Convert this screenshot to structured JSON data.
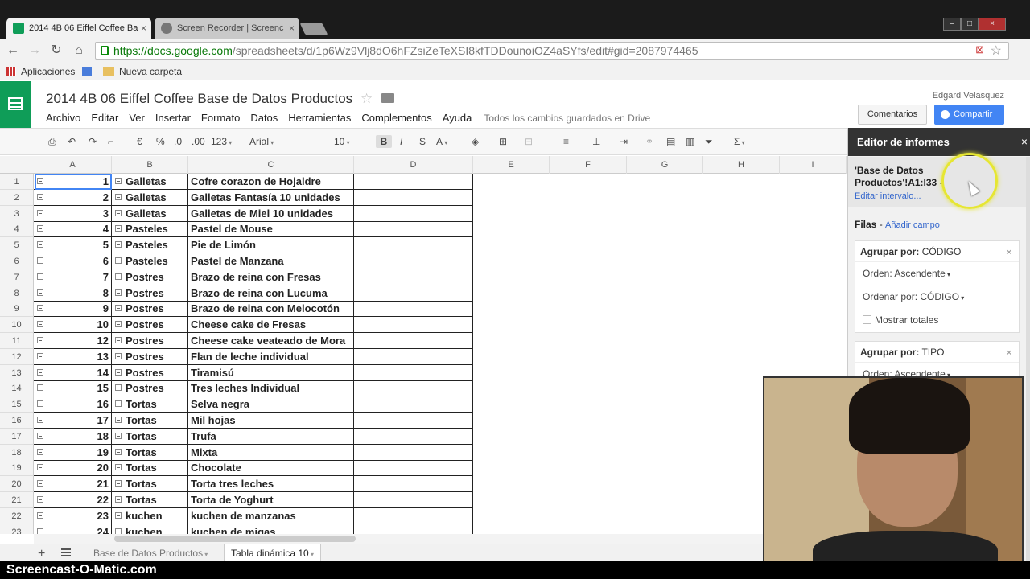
{
  "browser": {
    "tabs": [
      {
        "label": "2014 4B 06 Eiffel Coffee Ba",
        "close": "×",
        "active": true
      },
      {
        "label": "Screen Recorder | Screenc",
        "close": "×",
        "active": false
      }
    ],
    "url_host": "https://docs.google.com",
    "url_path": "/spreadsheets/d/1p6Wz9Vlj8dO6hFZsiZeTeXSI8kfTDDounoiOZ4aSYfs/edit#gid=2087974465",
    "bookmarks": [
      "Aplicaciones",
      "Nueva carpeta"
    ]
  },
  "doc": {
    "title": "2014 4B 06 Eiffel Coffee Base de Datos Productos",
    "menu": [
      "Archivo",
      "Editar",
      "Ver",
      "Insertar",
      "Formato",
      "Datos",
      "Herramientas",
      "Complementos",
      "Ayuda"
    ],
    "saved_status": "Todos los cambios guardados en Drive",
    "user": "Edgard Velasquez",
    "comments_label": "Comentarios",
    "share_label": "Compartir"
  },
  "toolbar": {
    "currency": "€",
    "percent": "%",
    "decimal_less": ".0",
    "decimal_more": ".00",
    "number_format": "123",
    "font": "Arial",
    "font_size": "10",
    "bold": "B",
    "italic": "I",
    "strike": "S",
    "text_color": "A",
    "functions": "Σ"
  },
  "grid": {
    "columns": [
      "A",
      "B",
      "C",
      "D",
      "E",
      "F",
      "G",
      "H",
      "I"
    ],
    "rows": [
      {
        "n": "1",
        "code": "1",
        "tipo": "Galletas",
        "nombre": "Cofre corazon de Hojaldre"
      },
      {
        "n": "2",
        "code": "2",
        "tipo": "Galletas",
        "nombre": "Galletas Fantasía 10 unidades"
      },
      {
        "n": "3",
        "code": "3",
        "tipo": "Galletas",
        "nombre": "Galletas de Miel 10 unidades"
      },
      {
        "n": "4",
        "code": "4",
        "tipo": "Pasteles",
        "nombre": "Pastel de Mouse"
      },
      {
        "n": "5",
        "code": "5",
        "tipo": "Pasteles",
        "nombre": "Pie de Limón"
      },
      {
        "n": "6",
        "code": "6",
        "tipo": "Pasteles",
        "nombre": "Pastel de Manzana"
      },
      {
        "n": "7",
        "code": "7",
        "tipo": "Postres",
        "nombre": "Brazo de reina con Fresas"
      },
      {
        "n": "8",
        "code": "8",
        "tipo": "Postres",
        "nombre": "Brazo de reina con Lucuma"
      },
      {
        "n": "9",
        "code": "9",
        "tipo": "Postres",
        "nombre": "Brazo de reina con Melocotón"
      },
      {
        "n": "10",
        "code": "10",
        "tipo": "Postres",
        "nombre": "Cheese cake de Fresas"
      },
      {
        "n": "11",
        "code": "12",
        "tipo": "Postres",
        "nombre": "Cheese cake veateado de Mora"
      },
      {
        "n": "12",
        "code": "13",
        "tipo": "Postres",
        "nombre": "Flan de leche individual"
      },
      {
        "n": "13",
        "code": "14",
        "tipo": "Postres",
        "nombre": "Tiramisú"
      },
      {
        "n": "14",
        "code": "15",
        "tipo": "Postres",
        "nombre": "Tres leches Individual"
      },
      {
        "n": "15",
        "code": "16",
        "tipo": "Tortas",
        "nombre": "Selva negra"
      },
      {
        "n": "16",
        "code": "17",
        "tipo": "Tortas",
        "nombre": "Mil hojas"
      },
      {
        "n": "17",
        "code": "18",
        "tipo": "Tortas",
        "nombre": "Trufa"
      },
      {
        "n": "18",
        "code": "19",
        "tipo": "Tortas",
        "nombre": "Mixta"
      },
      {
        "n": "19",
        "code": "20",
        "tipo": "Tortas",
        "nombre": "Chocolate"
      },
      {
        "n": "20",
        "code": "21",
        "tipo": "Tortas",
        "nombre": "Torta tres leches"
      },
      {
        "n": "21",
        "code": "22",
        "tipo": "Tortas",
        "nombre": "Torta de Yoghurt"
      },
      {
        "n": "22",
        "code": "23",
        "tipo": "kuchen",
        "nombre": "kuchen de manzanas"
      },
      {
        "n": "23",
        "code": "24",
        "tipo": "kuchen",
        "nombre": "kuchen de migas"
      }
    ]
  },
  "sheet_tabs": {
    "add": "+",
    "tabs": [
      "Base de Datos Productos",
      "Tabla dinámica 10"
    ]
  },
  "panel": {
    "title": "Editor de informes",
    "close": "×",
    "range_label": "'Base de Datos Productos'!A1:I33",
    "range_suffix": "-",
    "edit_range": "Editar intervalo...",
    "rows_label": "Filas",
    "rows_sep": "-",
    "add_field": "Añadir campo",
    "group_prefix": "Agrupar por:",
    "groups": [
      {
        "field": "CÓDIGO",
        "order_label": "Orden:",
        "order": "Ascendente",
        "sort_label": "Ordenar por:",
        "sort": "CÓDIGO",
        "totals": "Mostrar totales"
      },
      {
        "field": "TIPO",
        "order_label": "Orden:",
        "order": "Ascendente"
      }
    ]
  },
  "watermark": "Screencast-O-Matic.com",
  "colors": {
    "sheets_green": "#0f9d58",
    "share_blue": "#4285f4",
    "link_blue": "#3366cc",
    "cursor_highlight": "#e6e632"
  }
}
